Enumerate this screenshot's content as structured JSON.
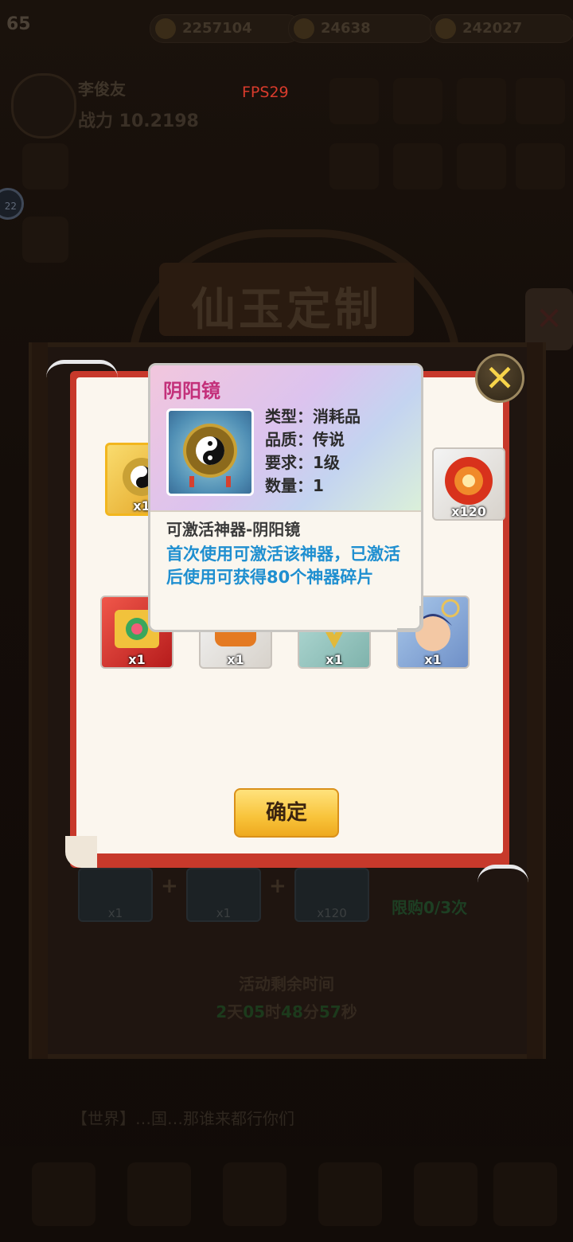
{
  "hud": {
    "level": "65",
    "fps": "FPS29",
    "resources": [
      "2257104",
      "24638",
      "242027"
    ],
    "player_name": "李俊友",
    "power": "战力 10.2198",
    "side_badge": "22"
  },
  "event": {
    "title": "仙玉定制",
    "limit_text": "限购0/3次",
    "timer_label": "活动剩余时间",
    "timer": {
      "d": "2",
      "d_unit": "天",
      "h": "05",
      "h_unit": "时",
      "m": "48",
      "m_unit": "分",
      "s": "57",
      "s_unit": "秒"
    },
    "chat_text": "【世界】…国…那谁来都行你们"
  },
  "reward_popup": {
    "confirm_label": "确定",
    "items": [
      {
        "name": "阴阳镜",
        "qty": "x1",
        "style": "gold"
      },
      {
        "name": "red-orb",
        "qty": "x120",
        "style": "white"
      },
      {
        "name": "red-chest",
        "qty": "x1",
        "style": "red"
      },
      {
        "name": "orange-scroll",
        "qty": "x1",
        "style": "white"
      },
      {
        "name": "jade-leaf",
        "qty": "x1",
        "style": "teal"
      },
      {
        "name": "hero-portrait",
        "qty": "x1",
        "style": "blue"
      }
    ]
  },
  "bottom_items": [
    "x1",
    "x1",
    "x120"
  ],
  "tooltip": {
    "name": "阴阳镜",
    "type": "类型：消耗品",
    "quality": "品质：传说",
    "requirement": "要求：1级",
    "quantity": "数量：1",
    "subtitle": "可激活神器-阴阳镜",
    "description": "首次使用可激活该神器，已激活后使用可获得80个神器碎片"
  },
  "colors": {
    "tooltip_name": "#c3307a",
    "description": "#1f8fd0",
    "panel_border": "#c7392b",
    "confirm": "#f8c33a",
    "close_x": "#f7d44a"
  }
}
